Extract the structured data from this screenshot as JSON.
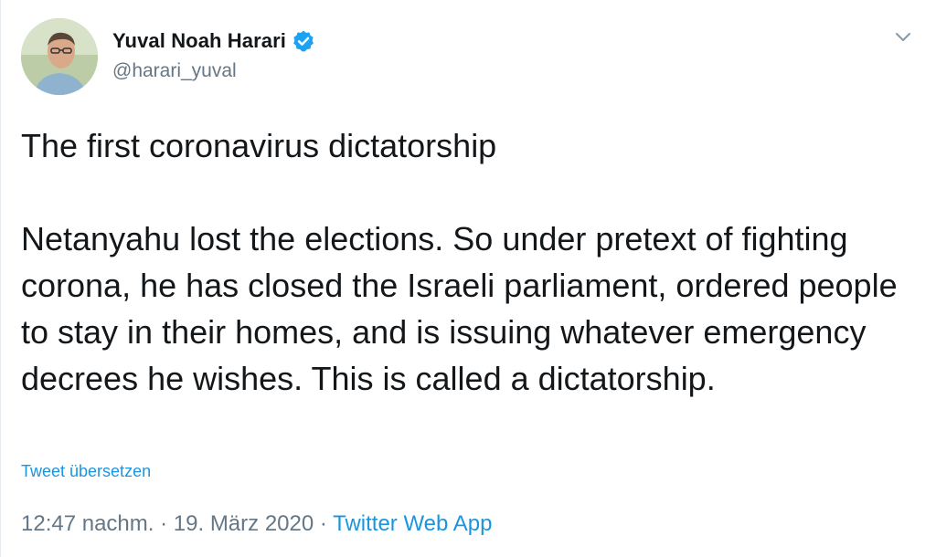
{
  "author": {
    "display_name": "Yuval Noah Harari",
    "handle": "@harari_yuval",
    "verified": true,
    "avatar_icon": "profile-photo"
  },
  "tweet": {
    "title_line": "The first coronavirus dictatorship",
    "paragraph": "Netanyahu lost the elections. So under pretext of fighting corona, he has closed the Israeli parliament, ordered people to stay in their homes, and is issuing whatever emergency decrees he wishes. This is called a dictatorship.",
    "translate_link": "Tweet übersetzen"
  },
  "meta": {
    "time": "12:47 nachm.",
    "separator": "·",
    "date": "19. März 2020",
    "source": "Twitter Web App"
  },
  "colors": {
    "link": "#1b95e0",
    "verified": "#1da1f2",
    "secondary_text": "#657786",
    "primary_text": "#14171a"
  },
  "icons": {
    "verified": "verified-badge-icon",
    "menu": "chevron-down-icon"
  }
}
